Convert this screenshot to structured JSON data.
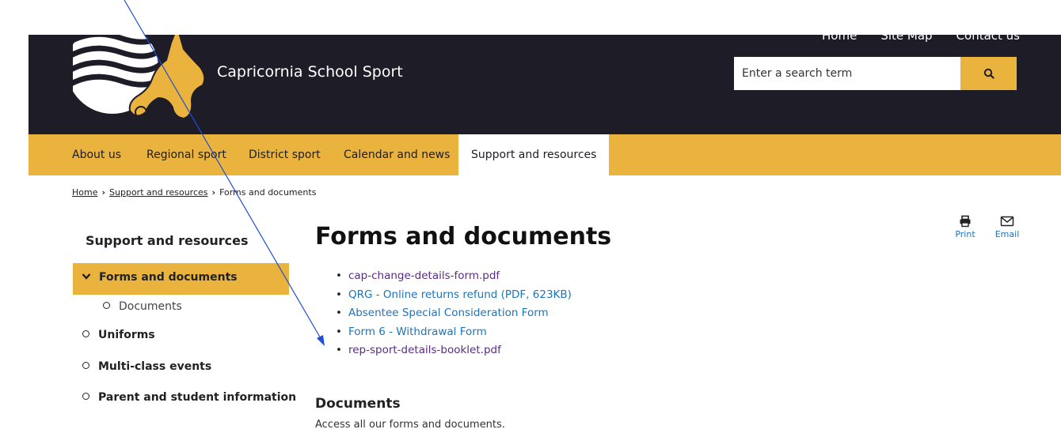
{
  "colors": {
    "header_bg": "#1e1c26",
    "accent": "#e9b33d",
    "link": "#1f73b7",
    "visited": "#5b2c83"
  },
  "header": {
    "site_title": "Capricornia School Sport",
    "top_links": [
      "Home",
      "Site Map",
      "Contact us"
    ],
    "search": {
      "placeholder": "Enter a search term",
      "button_icon": "search-icon"
    }
  },
  "nav": {
    "items": [
      "About us",
      "Regional sport",
      "District sport",
      "Calendar and news",
      "Support and resources"
    ],
    "active": "Support and resources"
  },
  "breadcrumb": [
    "Home",
    "Support and resources",
    "Forms and documents"
  ],
  "sidebar": {
    "title": "Support and resources",
    "items": [
      "Forms and documents",
      "Documents",
      "Uniforms",
      "Multi-class events",
      "Parent and student information"
    ],
    "active": "Forms and documents"
  },
  "main": {
    "title": "Forms and documents",
    "documents": [
      "cap-change-details-form.pdf",
      "QRG - Online returns refund (PDF, 623KB)",
      "Absentee Special Consideration Form",
      "Form 6 - Withdrawal Form",
      "rep-sport-details-booklet.pdf"
    ],
    "section_title": "Documents",
    "section_desc": "Access all our forms and documents."
  },
  "tools": {
    "print": "Print",
    "email": "Email",
    "print_icon": "printer-icon",
    "email_icon": "envelope-icon"
  },
  "annotation": {
    "arrow_color": "#1f4fd6"
  }
}
